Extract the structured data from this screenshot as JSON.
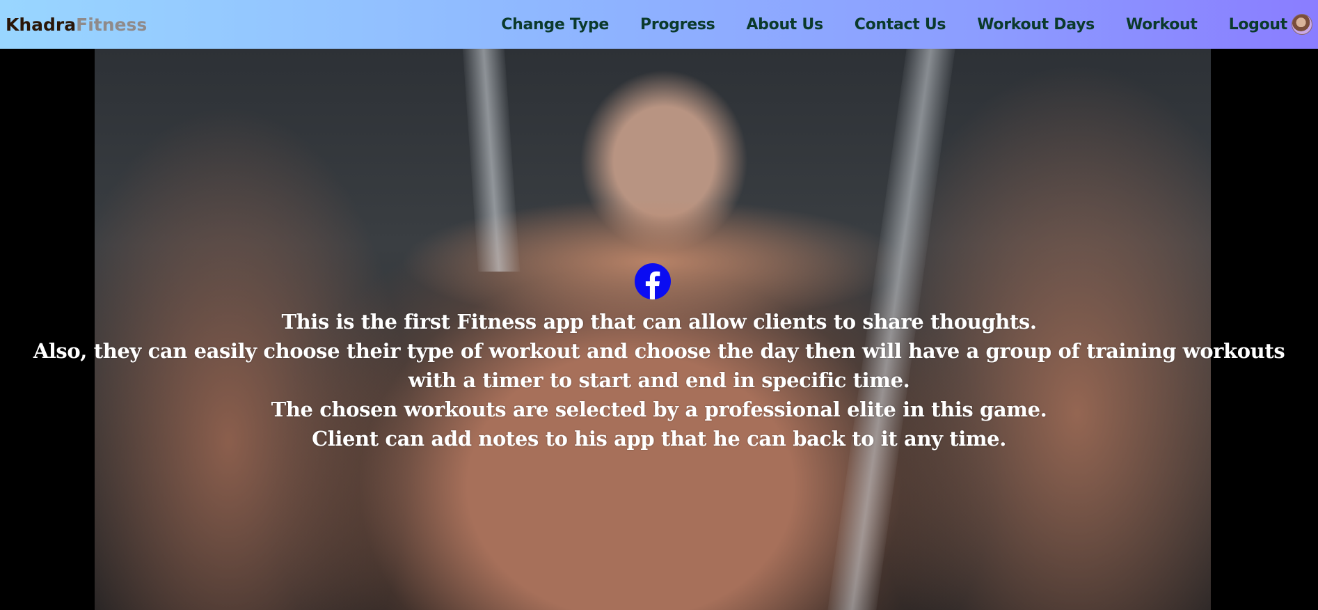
{
  "brand": {
    "part1": "Khadra",
    "part2": "Fitness"
  },
  "nav": {
    "items": [
      {
        "label": "Change Type"
      },
      {
        "label": "Progress"
      },
      {
        "label": "About Us"
      },
      {
        "label": "Contact Us"
      },
      {
        "label": "Workout Days"
      },
      {
        "label": "Workout"
      },
      {
        "label": "Logout"
      }
    ]
  },
  "icons": {
    "social": "facebook-icon",
    "profile": "avatar"
  },
  "about": {
    "lines": [
      "This is the first Fitness app that can allow clients to share thoughts.",
      "Also, they can easily choose their type of workout and choose the day then will have a group of training workouts with a timer to start and end in specific time.",
      "The chosen workouts are selected by a professional elite in this game.",
      "Client can add notes to his app that he can back to it any time."
    ]
  },
  "colors": {
    "facebook": "#0a0cf2",
    "nav_text": "#0b3a2c",
    "brand_dark": "#2a1608",
    "brand_light": "#8f8a8a"
  }
}
